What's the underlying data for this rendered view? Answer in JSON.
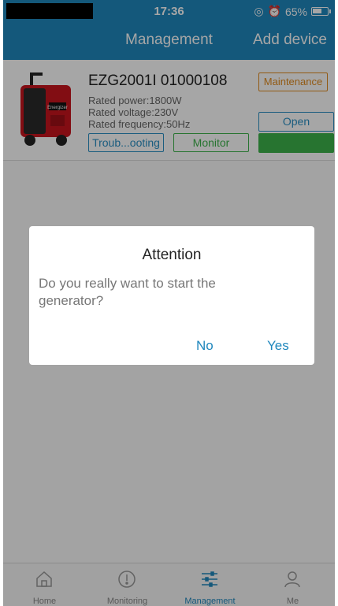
{
  "status_bar": {
    "time": "17:36",
    "battery": "65%",
    "battery_level": 0.65
  },
  "header": {
    "title": "Management",
    "action": "Add device"
  },
  "device": {
    "name": "EZG2001I 01000108",
    "rated_power": "Rated power:1800W",
    "rated_voltage": "Rated voltage:230V",
    "rated_frequency": "Rated frequency:50Hz",
    "status_badge": "Maintenance",
    "open_label": "Open",
    "troubleshooting_label": "Troub...ooting",
    "monitor_label": "Monitor",
    "brand_logo": "Energizer"
  },
  "dialog": {
    "title": "Attention",
    "message": "Do you really want to start the generator?",
    "no_label": "No",
    "yes_label": "Yes"
  },
  "tabs": [
    {
      "label": "Home",
      "icon": "home-icon"
    },
    {
      "label": "Monitoring",
      "icon": "gauge-icon"
    },
    {
      "label": "Management",
      "icon": "sliders-icon"
    },
    {
      "label": "Me",
      "icon": "user-icon"
    }
  ],
  "colors": {
    "primary": "#1f87bd",
    "maintenance": "#e08a1e",
    "green": "#3cb34a"
  }
}
